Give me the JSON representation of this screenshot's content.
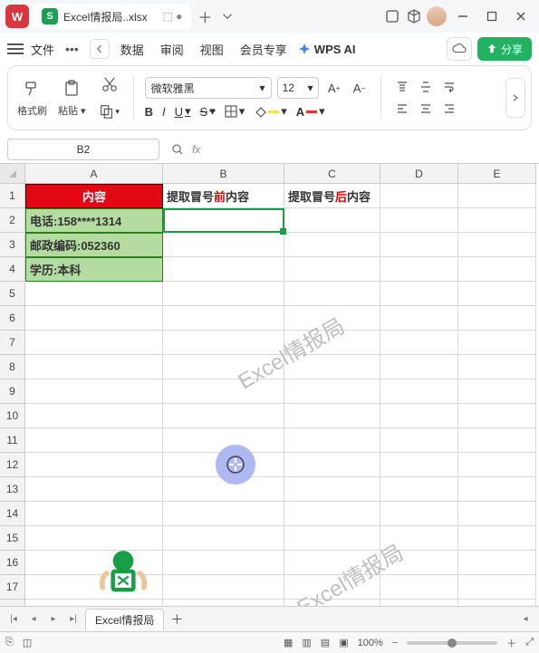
{
  "titlebar": {
    "app_initial": "W",
    "tab_icon": "S",
    "tab_name": "Excel情报局..xlsx",
    "tab_dots": "⠀⬚ ●"
  },
  "menubar": {
    "file": "文件",
    "items": [
      "数据",
      "审阅",
      "视图",
      "会员专享"
    ],
    "ai": "WPS AI",
    "share": "分享"
  },
  "toolbar": {
    "fmt_paint": "格式刷",
    "paste": "粘贴",
    "font_name": "微软雅黑",
    "font_size": "12",
    "bold": "B",
    "italic": "I",
    "underline": "U",
    "strike": "S"
  },
  "formula": {
    "name_box": "B2",
    "fx": "fx"
  },
  "columns": [
    "A",
    "B",
    "C",
    "D",
    "E"
  ],
  "col_widths_cls": [
    "cA",
    "cB",
    "cC",
    "cD",
    "cE"
  ],
  "row_count": 19,
  "headers": {
    "A1": "内容",
    "B1_pre": "提取冒号",
    "B1_mid": "前",
    "B1_post": "内容",
    "C1_pre": "提取冒号",
    "C1_mid": "后",
    "C1_post": "内容"
  },
  "dataA": {
    "A2": "电话:158****1314",
    "A3": "邮政编码:052360",
    "A4": "学历:本科"
  },
  "watermark_text": "Excel情报局",
  "sheettabs": {
    "name": "Excel情报局"
  },
  "status": {
    "zoom": "100%"
  }
}
